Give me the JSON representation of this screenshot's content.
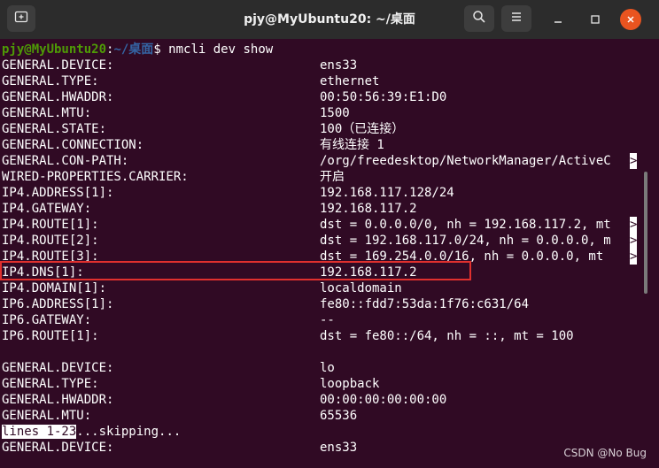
{
  "window": {
    "title": "pjy@MyUbuntu20: ~/桌面"
  },
  "prompt": {
    "user_host": "pjy@MyUbuntu20",
    "colon": ":",
    "path": "~/桌面",
    "dollar_command": "$ nmcli dev show"
  },
  "rows": [
    {
      "key": "GENERAL.DEVICE:",
      "value": "ens33"
    },
    {
      "key": "GENERAL.TYPE:",
      "value": "ethernet"
    },
    {
      "key": "GENERAL.HWADDR:",
      "value": "00:50:56:39:E1:D0"
    },
    {
      "key": "GENERAL.MTU:",
      "value": "1500"
    },
    {
      "key": "GENERAL.STATE:",
      "value": "100（已连接）"
    },
    {
      "key": "GENERAL.CONNECTION:",
      "value": "有线连接 1"
    },
    {
      "key": "GENERAL.CON-PATH:",
      "value": "/org/freedesktop/NetworkManager/ActiveC"
    },
    {
      "key": "WIRED-PROPERTIES.CARRIER:",
      "value": "开启"
    },
    {
      "key": "IP4.ADDRESS[1]:",
      "value": "192.168.117.128/24"
    },
    {
      "key": "IP4.GATEWAY:",
      "value": "192.168.117.2"
    },
    {
      "key": "IP4.ROUTE[1]:",
      "value": "dst = 0.0.0.0/0, nh = 192.168.117.2, mt"
    },
    {
      "key": "IP4.ROUTE[2]:",
      "value": "dst = 192.168.117.0/24, nh = 0.0.0.0, m"
    },
    {
      "key": "IP4.ROUTE[3]:",
      "value": "dst = 169.254.0.0/16, nh = 0.0.0.0, mt "
    },
    {
      "key": "IP4.DNS[1]:",
      "value": "192.168.117.2"
    },
    {
      "key": "IP4.DOMAIN[1]:",
      "value": "localdomain"
    },
    {
      "key": "IP6.ADDRESS[1]:",
      "value": "fe80::fdd7:53da:1f76:c631/64"
    },
    {
      "key": "IP6.GATEWAY:",
      "value": "--"
    },
    {
      "key": "IP6.ROUTE[1]:",
      "value": "dst = fe80::/64, nh = ::, mt = 100"
    },
    {
      "key": "",
      "value": ""
    },
    {
      "key": "GENERAL.DEVICE:",
      "value": "lo"
    },
    {
      "key": "GENERAL.TYPE:",
      "value": "loopback"
    },
    {
      "key": "GENERAL.HWADDR:",
      "value": "00:00:00:00:00:00"
    },
    {
      "key": "GENERAL.MTU:",
      "value": "65536"
    }
  ],
  "truncation_marker": ">",
  "pager": {
    "status": "lines 1-23",
    "message": "...skipping..."
  },
  "after_skip": {
    "key": "GENERAL.DEVICE:",
    "value": "ens33"
  },
  "watermark": "CSDN @No  Bug",
  "colors": {
    "terminal_bg": "#300a24",
    "prompt_user": "#4e9a06",
    "prompt_path": "#3465a4",
    "highlight_box": "#e0302e",
    "close_button": "#e95420"
  }
}
